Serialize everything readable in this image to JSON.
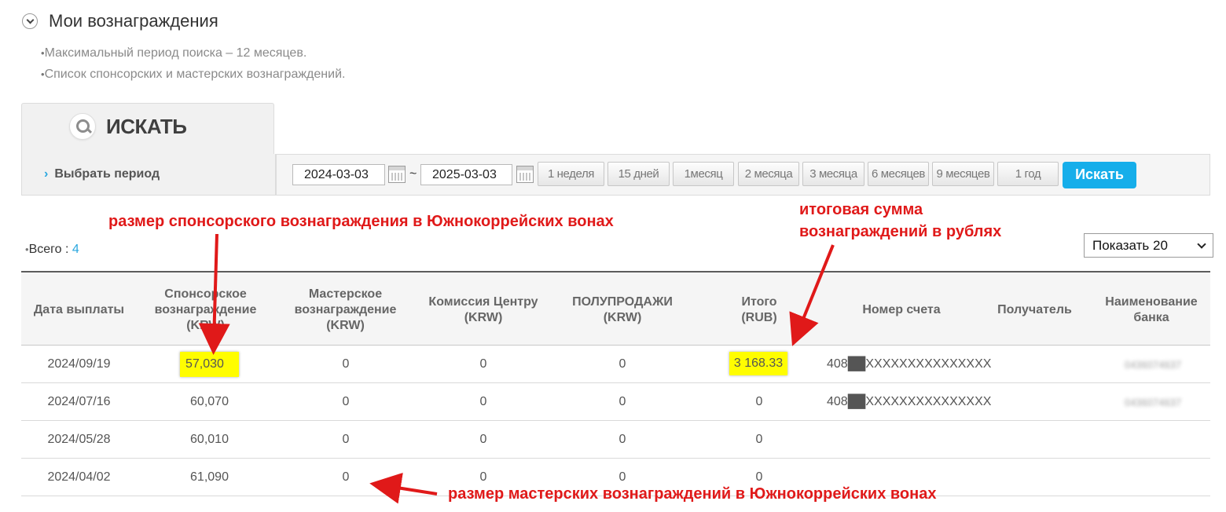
{
  "section": {
    "title": "Мои вознаграждения",
    "notes": [
      "Максимальный период поиска – 12 месяцев.",
      "Список спонсорских и мастерских вознаграждений."
    ]
  },
  "search": {
    "tab_label": "ИСКАТЬ",
    "period_label": "Выбрать период",
    "date_from": "2024-03-03",
    "date_to": "2025-03-03",
    "separator": "~",
    "periods": [
      "1 неделя",
      "15 дней",
      "1месяц",
      "2 месяца",
      "3 месяца",
      "6 месяцев",
      "9 месяцев",
      "1 год"
    ],
    "submit_label": "Искать"
  },
  "results": {
    "total_label": "Всего :",
    "total_count": "4",
    "page_size": "Показать 20"
  },
  "table": {
    "headers": [
      "Дата выплаты",
      "Спонсорское вознаграждение (KRW)",
      "Мастерское вознаграждение (KRW)",
      "Комиссия Центру (KRW)",
      "ПОЛУПРОДАЖИ (KRW)",
      "Итого (RUB)",
      "Номер счета",
      "Получатель",
      "Наименование банка"
    ],
    "rows": [
      {
        "date": "2024/09/19",
        "sponsor": "57,030",
        "master": "0",
        "center_fee": "0",
        "half_sales": "0",
        "total": "3 168.33",
        "account": "408██XXXXXXXXXXXXXXX",
        "recipient": "",
        "bank": "0436074637"
      },
      {
        "date": "2024/07/16",
        "sponsor": "60,070",
        "master": "0",
        "center_fee": "0",
        "half_sales": "0",
        "total": "0",
        "account": "408██XXXXXXXXXXXXXXX",
        "recipient": "",
        "bank": "0436074637"
      },
      {
        "date": "2024/05/28",
        "sponsor": "60,010",
        "master": "0",
        "center_fee": "0",
        "half_sales": "0",
        "total": "0",
        "account": "",
        "recipient": "",
        "bank": ""
      },
      {
        "date": "2024/04/02",
        "sponsor": "61,090",
        "master": "0",
        "center_fee": "0",
        "half_sales": "0",
        "total": "0",
        "account": "",
        "recipient": "",
        "bank": ""
      }
    ]
  },
  "annotations": {
    "sponsor_note": "размер спонсорского вознаграждения в Южнокоррейских вонах",
    "total_note_1": "итоговая сумма",
    "total_note_2": "вознаграждений в рублях",
    "master_note": "размер мастерских вознаграждений в Южнокоррейских вонах",
    "color": "#e01919",
    "highlight_color": "#fffd00"
  }
}
